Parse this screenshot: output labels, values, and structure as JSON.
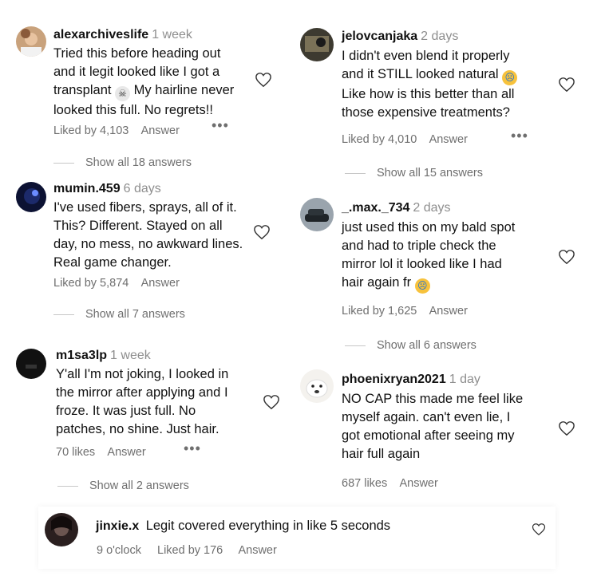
{
  "comments": [
    {
      "user": "alexarchiveslife",
      "age": "1 week",
      "lines": [
        "Tried this before heading out",
        "and it legit looked like I got a",
        "transplant",
        "My hairline never",
        "looked this full. No regrets!!"
      ],
      "emoji": "skull",
      "likes": "Liked by 4,103",
      "answer": "Answer",
      "show": "Show all 18 answers"
    },
    {
      "user": "mumin.459",
      "age": "6 days",
      "lines": [
        "I've used fibers, sprays, all of it.",
        "This? Different. Stayed on all",
        "day, no mess, no awkward lines.",
        "Real game changer."
      ],
      "likes": "Liked by 5,874",
      "answer": "Answer",
      "show": "Show all 7 answers"
    },
    {
      "user": "m1sa3lp",
      "age": "1 week",
      "lines": [
        "Y'all I'm not joking, I looked in",
        "the mirror after applying and I",
        "froze. It was just full. No",
        "patches, no shine. Just hair."
      ],
      "likes": "70 likes",
      "answer": "Answer",
      "show": "Show all 2 answers"
    },
    {
      "user": "jelovcanjaka",
      "age": "2 days",
      "lines": [
        "I didn't even blend it properly",
        "and it STILL looked natural",
        "Like how is this better than all",
        "those expensive treatments?"
      ],
      "emoji": "cry",
      "likes": "Liked by 4,010",
      "answer": "Answer",
      "show": "Show all 15 answers"
    },
    {
      "user": "_.max._734",
      "age": "2 days",
      "lines": [
        "just used this on my bald spot",
        "and had to triple check the",
        "mirror lol it looked like I had",
        "hair again fr"
      ],
      "emoji": "cry",
      "likes": "Liked by 1,625",
      "answer": "Answer",
      "show": "Show all 6 answers"
    },
    {
      "user": "phoenixryan2021",
      "age": "1 day",
      "lines": [
        "NO CAP this made me feel like",
        "myself again. can't even lie, I",
        "got emotional after seeing my",
        "hair full again"
      ],
      "likes": "687 likes",
      "answer": "Answer"
    }
  ],
  "bottom": {
    "user": "jinxie.x",
    "text": "Legit covered everything in like 5 seconds",
    "time": "9 o'clock",
    "likes": "Liked by 176",
    "answer": "Answer"
  },
  "icons": {
    "heart": "heart-outline-icon",
    "more": "more-dots-icon",
    "skull": "skull-emoji-icon",
    "cry": "crying-emoji-icon"
  }
}
